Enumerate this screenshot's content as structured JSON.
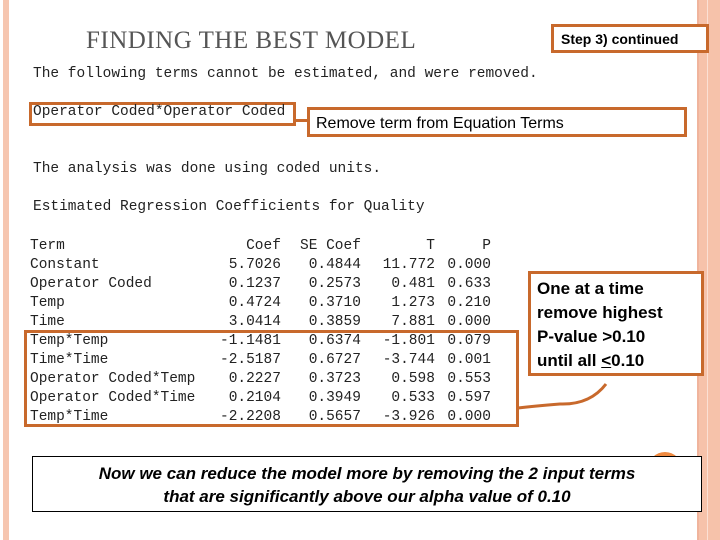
{
  "title": "FINDING THE BEST MODEL",
  "step_label": "Step 3) continued",
  "removed_notice": "The following terms cannot be estimated, and were removed.",
  "removed_term": "Operator Coded*Operator Coded",
  "remove_callout": "Remove term from Equation Terms",
  "coded_units_note": "The analysis was done using coded units.",
  "coef_heading": "Estimated Regression Coefficients for Quality",
  "table": {
    "headers": [
      "Term",
      "Coef",
      "SE Coef",
      "T",
      "P"
    ],
    "rows": [
      [
        "Constant",
        "5.7026",
        "0.4844",
        "11.772",
        "0.000"
      ],
      [
        "Operator Coded",
        "0.1237",
        "0.2573",
        "0.481",
        "0.633"
      ],
      [
        "Temp",
        "0.4724",
        "0.3710",
        "1.273",
        "0.210"
      ],
      [
        "Time",
        "3.0414",
        "0.3859",
        "7.881",
        "0.000"
      ],
      [
        "Temp*Temp",
        "-1.1481",
        "0.6374",
        "-1.801",
        "0.079"
      ],
      [
        "Time*Time",
        "-2.5187",
        "0.6727",
        "-3.744",
        "0.001"
      ],
      [
        "Operator Coded*Temp",
        "0.2227",
        "0.3723",
        "0.598",
        "0.553"
      ],
      [
        "Operator Coded*Time",
        "0.2104",
        "0.3949",
        "0.533",
        "0.597"
      ],
      [
        "Temp*Time",
        "-2.2208",
        "0.5657",
        "-3.926",
        "0.000"
      ]
    ]
  },
  "pvalue_callout": {
    "line1": "One at a time",
    "line2": "remove highest",
    "line3": "P-value >0.10",
    "line4_prefix": "until all ",
    "line4_underlined": "<",
    "line4_suffix": "0.10"
  },
  "bottom_note": {
    "line1": "Now we can reduce the model more by removing the 2 input terms",
    "line2": "that are significantly above our alpha value of 0.10"
  },
  "colors": {
    "accent": "#c8692c",
    "border_pink": "#f6c2aa",
    "title": "#555555"
  }
}
